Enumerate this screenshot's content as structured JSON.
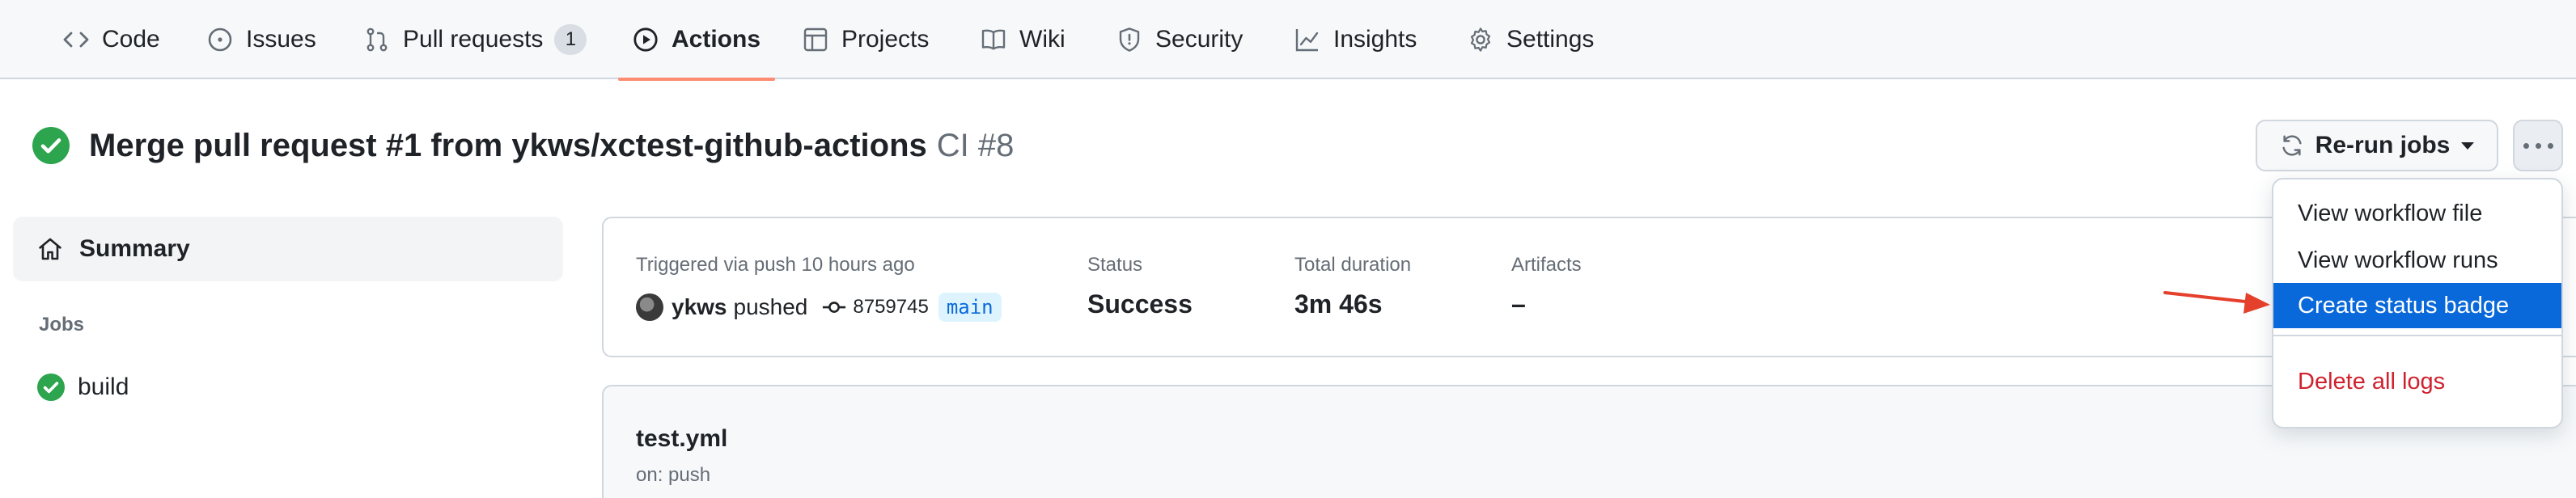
{
  "nav": {
    "tabs": [
      {
        "label": "Code",
        "icon": "code-icon"
      },
      {
        "label": "Issues",
        "icon": "issue-icon"
      },
      {
        "label": "Pull requests",
        "icon": "pull-request-icon",
        "count": "1"
      },
      {
        "label": "Actions",
        "icon": "play-icon",
        "active": true
      },
      {
        "label": "Projects",
        "icon": "table-icon"
      },
      {
        "label": "Wiki",
        "icon": "book-icon"
      },
      {
        "label": "Security",
        "icon": "shield-icon"
      },
      {
        "label": "Insights",
        "icon": "graph-icon"
      },
      {
        "label": "Settings",
        "icon": "gear-icon"
      }
    ]
  },
  "header": {
    "title": "Merge pull request #1 from ykws/xctest-github-actions",
    "subtitle": "CI #8",
    "rerun_label": "Re-run jobs"
  },
  "sidebar": {
    "summary_label": "Summary",
    "jobs_label": "Jobs",
    "jobs": [
      {
        "label": "build",
        "status": "success"
      }
    ]
  },
  "run": {
    "trigger_label": "Triggered via push 10 hours ago",
    "actor": "ykws",
    "action": "pushed",
    "commit_sha": "8759745",
    "branch": "main",
    "status_label": "Status",
    "status_value": "Success",
    "duration_label": "Total duration",
    "duration_value": "3m 46s",
    "artifacts_label": "Artifacts",
    "artifacts_value": "–"
  },
  "workflow": {
    "file": "test.yml",
    "trigger": "on: push"
  },
  "menu": {
    "items": [
      {
        "label": "View workflow file"
      },
      {
        "label": "View workflow runs"
      },
      {
        "label": "Create status badge",
        "selected": true
      },
      {
        "label": "Delete all logs",
        "danger": true
      }
    ]
  },
  "colors": {
    "success": "#2da44e",
    "accent": "#0969da",
    "danger": "#cf222e",
    "nav_underline": "#fd8c73",
    "annotation_arrow": "#e5402b"
  }
}
